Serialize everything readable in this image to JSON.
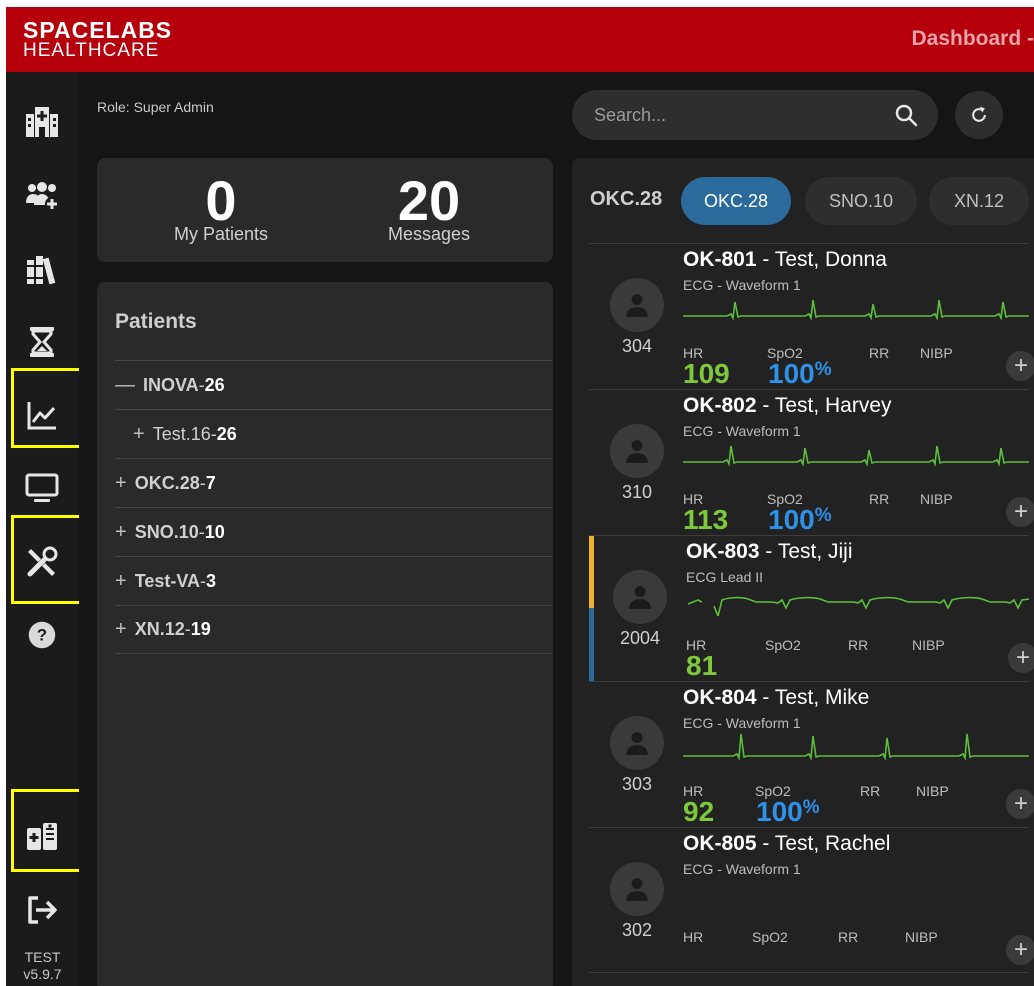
{
  "header": {
    "brand_line1": "SPACELABS",
    "brand_line2": "HEALTHCARE",
    "title": "Dashboard -"
  },
  "sidebar": {
    "icons": [
      "hospital-icon",
      "users-add-icon",
      "library-icon",
      "hourglass-icon",
      "chart-line-icon",
      "monitor-icon",
      "tools-icon",
      "help-icon",
      "medical-device-icon",
      "logout-icon"
    ],
    "env": "TEST",
    "version": "v5.9.7"
  },
  "role": "Role: Super Admin",
  "stats": {
    "my_patients_count": "0",
    "my_patients_label": "My Patients",
    "messages_count": "20",
    "messages_label": "Messages"
  },
  "patients": {
    "title": "Patients",
    "rows": [
      {
        "sym": "—",
        "name": "INOVA",
        "sep": " - ",
        "count": "26"
      },
      {
        "sym": "+",
        "name": "Test.16",
        "sep": " - ",
        "count": "26"
      },
      {
        "sym": "+",
        "name": "OKC.28",
        "sep": " - ",
        "count": "7"
      },
      {
        "sym": "+",
        "name": "SNO.10",
        "sep": " - ",
        "count": "10"
      },
      {
        "sym": "+",
        "name": "Test-VA",
        "sep": " - ",
        "count": "3"
      },
      {
        "sym": "+",
        "name": "XN.12",
        "sep": " - ",
        "count": "19"
      }
    ]
  },
  "search": {
    "placeholder": "Search..."
  },
  "units": {
    "current": "OKC.28",
    "tabs": [
      "OKC.28",
      "SNO.10",
      "XN.12"
    ]
  },
  "vital_labels": {
    "hr": "HR",
    "spo2": "SpO2",
    "rr": "RR",
    "nibp": "NIBP"
  },
  "colors": {
    "header_red": "#b5000c",
    "hr_green": "#7ec83c",
    "spo2_blue": "#2f90e8",
    "waveform_green": "#5bbf3a",
    "alert_yellow": "#f0b12e",
    "alert_blue": "#2b6b9c"
  },
  "patient_list": [
    {
      "id": "OK-801",
      "name": "Test, Donna",
      "waveform": "ECG - Waveform 1",
      "room": "304",
      "hr": "109",
      "spo2": "100",
      "spo2_unit": "%"
    },
    {
      "id": "OK-802",
      "name": "Test, Harvey",
      "waveform": "ECG - Waveform 1",
      "room": "310",
      "hr": "113",
      "spo2": "100",
      "spo2_unit": "%"
    },
    {
      "id": "OK-803",
      "name": "Test, Jiji",
      "waveform": "ECG Lead II",
      "room": "2004",
      "hr": "81",
      "spo2": "",
      "spo2_unit": ""
    },
    {
      "id": "OK-804",
      "name": "Test, Mike",
      "waveform": "ECG - Waveform 1",
      "room": "303",
      "hr": "92",
      "spo2": "100",
      "spo2_unit": "%"
    },
    {
      "id": "OK-805",
      "name": "Test, Rachel",
      "waveform": "ECG - Waveform 1",
      "room": "302",
      "hr": "",
      "spo2": "",
      "spo2_unit": ""
    }
  ]
}
